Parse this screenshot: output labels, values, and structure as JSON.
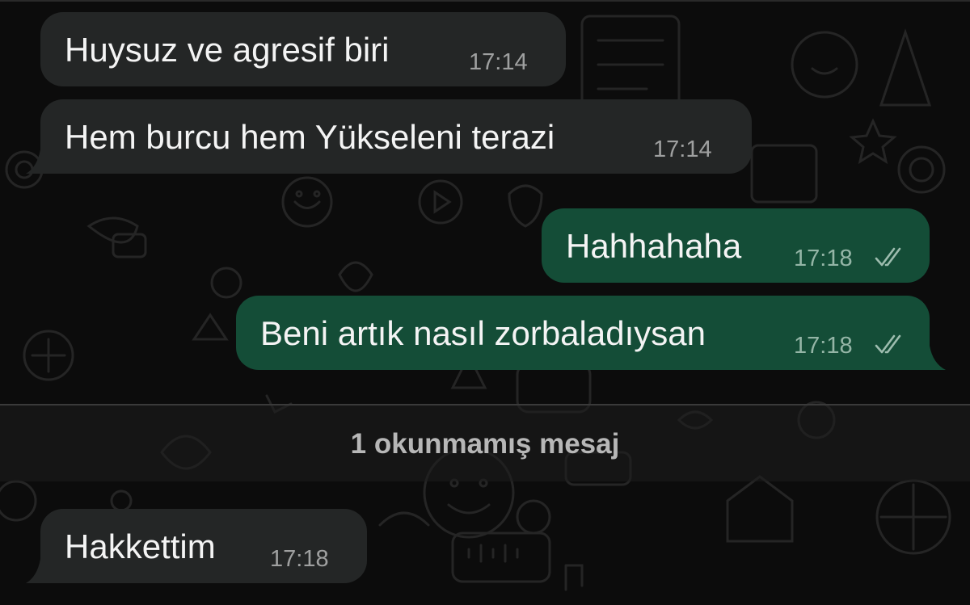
{
  "messages": [
    {
      "direction": "incoming",
      "text": "Huysuz ve agresif biri",
      "time": "17:14"
    },
    {
      "direction": "incoming",
      "text": "Hem burcu hem Yükseleni terazi",
      "time": "17:14"
    },
    {
      "direction": "outgoing",
      "text": "Hahhahaha",
      "time": "17:18",
      "status": "read-double-check-icon"
    },
    {
      "direction": "outgoing",
      "text": "Beni artık nasıl zorbaladıysan",
      "time": "17:18",
      "status": "read-double-check-icon"
    },
    {
      "direction": "incoming",
      "text": "Hakkettim",
      "time": "17:18"
    }
  ],
  "unread_divider": {
    "label": "1 okunmamış mesaj"
  },
  "colors": {
    "background": "#0c0c0c",
    "incoming_bubble": "#242626",
    "outgoing_bubble": "#144d37",
    "text": "#f4f4f4",
    "divider_text": "#b7b7b7"
  }
}
